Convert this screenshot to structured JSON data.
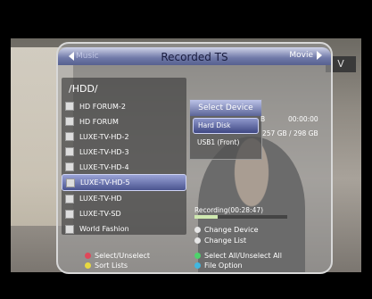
{
  "header": {
    "back_label": "Music",
    "title": "Recorded TS",
    "next_label": "Movie"
  },
  "path": "/HDD/",
  "files": [
    "HD FORUM-2",
    "HD FORUM",
    "LUXE-TV-HD-2",
    "LUXE-TV-HD-3",
    "LUXE-TV-HD-4",
    "LUXE-TV-HD-5",
    "LUXE-TV-HD",
    "LUXE-TV-SD",
    "World Fashion"
  ],
  "selected_index": 5,
  "device_popup": {
    "title": "Select Device",
    "options": [
      "Hard Disk",
      "USB1 (Front)"
    ],
    "selected": 0
  },
  "info": {
    "size_suffix": "B",
    "time": "00:00:00",
    "usage": "257 GB / 298 GB"
  },
  "recording": {
    "text": "Recording(00:28:47)",
    "progress": 0.25
  },
  "side_hints": {
    "change_device": "Change Device",
    "change_list": "Change List"
  },
  "footer": {
    "red": "Select/Unselect",
    "yellow": "Sort Lists",
    "green": "Select All/Unselect All",
    "blue": "File Option"
  },
  "colors": {
    "highlight": "#4a5490",
    "title_bar": "#6f78a8"
  }
}
